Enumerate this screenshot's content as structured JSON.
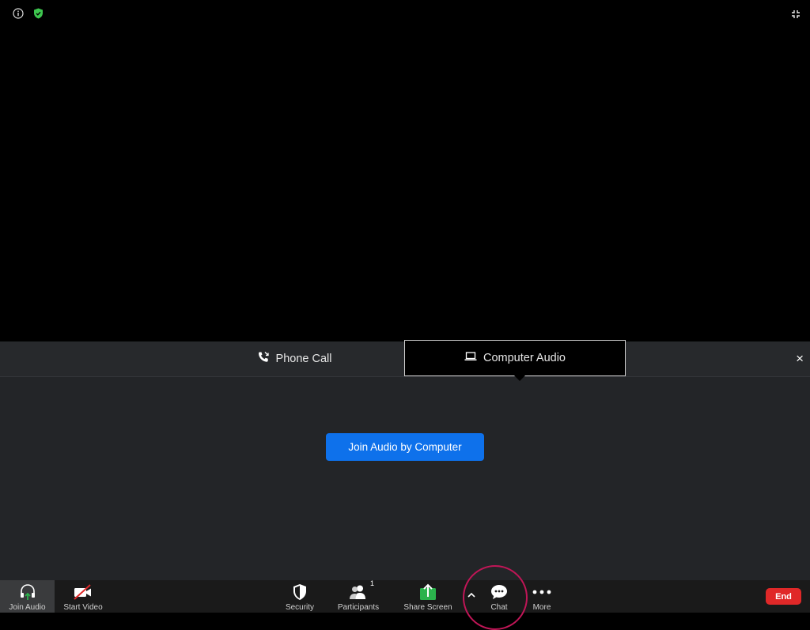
{
  "top_bar": {
    "icons": [
      "info-icon",
      "shield-check-icon"
    ],
    "fullscreen_icon": "fullscreen-exit-icon"
  },
  "audio_panel": {
    "tabs": [
      {
        "label": "Phone Call",
        "icon": "phone-call-icon",
        "selected": false
      },
      {
        "label": "Computer Audio",
        "icon": "laptop-icon",
        "selected": true
      }
    ],
    "close_label": "×",
    "join_button_label": "Join Audio by Computer"
  },
  "toolbar": {
    "join_audio_label": "Join Audio",
    "start_video_label": "Start Video",
    "security_label": "Security",
    "participants_label": "Participants",
    "participants_count": "1",
    "share_screen_label": "Share Screen",
    "chat_label": "Chat",
    "more_label": "More",
    "end_label": "End"
  },
  "colors": {
    "accent_blue": "#0e71eb",
    "end_red": "#e02828",
    "share_green": "#2bb24c",
    "shield_green": "#3ec64f",
    "highlight_ring": "#c01657"
  }
}
